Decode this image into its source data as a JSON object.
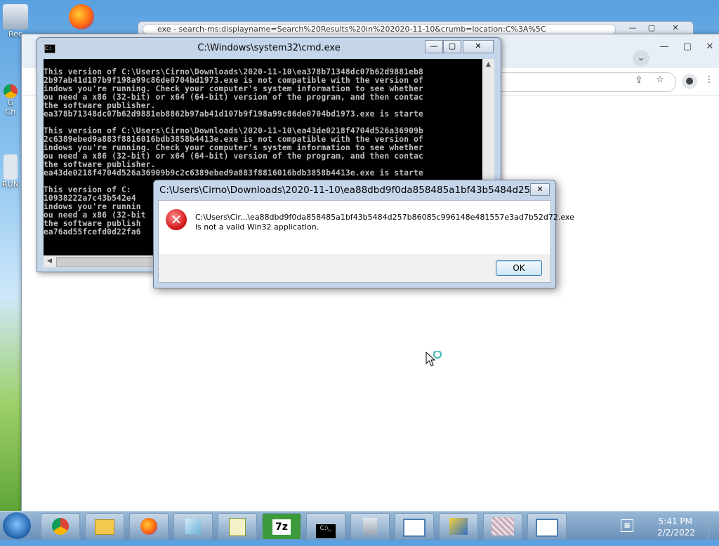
{
  "desktop": {
    "icons": [
      {
        "label": "Rec"
      },
      {
        "label": "G\nCh"
      },
      {
        "label": "RUN"
      }
    ]
  },
  "browser_back": {
    "address": "exe - search-ms:displayname=Search%20Results%20in%202020-11-10&crumb=location:C%3A%5C"
  },
  "cmd": {
    "title": "C:\\Windows\\system32\\cmd.exe",
    "console_lines": [
      "This version of C:\\Users\\Cirno\\Downloads\\2020-11-10\\ea378b71348dc07b62d9881eb8",
      "2b97ab41d107b9f198a99c86de0704bd1973.exe is not compatible with the version of",
      "indows you're running. Check your computer's system information to see whether",
      "ou need a x86 (32-bit) or x64 (64-bit) version of the program, and then contac",
      "the software publisher.",
      "ea378b71348dc07b62d9881eb8862b97ab41d107b9f198a99c86de0704bd1973.exe is starte",
      "",
      "This version of C:\\Users\\Cirno\\Downloads\\2020-11-10\\ea43de0218f4704d526a36909b",
      "2c6389ebed9a883f8816016bdb3858b4413e.exe is not compatible with the version of",
      "indows you're running. Check your computer's system information to see whether",
      "ou need a x86 (32-bit) or x64 (64-bit) version of the program, and then contac",
      "the software publisher.",
      "ea43de0218f4704d526a36909b9c2c6389ebed9a883f8816016bdb3858b4413e.exe is starte",
      "",
      "This version of C:",
      "10938222a7c43b542e4",
      "indows you're runnin",
      "ou need a x86 (32-bit",
      "the software publish",
      "ea76ad55fcefd0d22fa6"
    ]
  },
  "error_dialog": {
    "title": "C:\\Users\\Cirno\\Downloads\\2020-11-10\\ea88dbd9f0da858485a1bf43b5484d25...",
    "message_line1": "C:\\Users\\Cir...\\ea88dbd9f0da858485a1bf43b5484d257b86085c996148e481557e3ad7b52d72.exe",
    "message_line2": "is not a valid Win32 application.",
    "ok_label": "OK"
  },
  "taskbar": {
    "time": "5:41 PM",
    "date": "2/2/2022"
  }
}
